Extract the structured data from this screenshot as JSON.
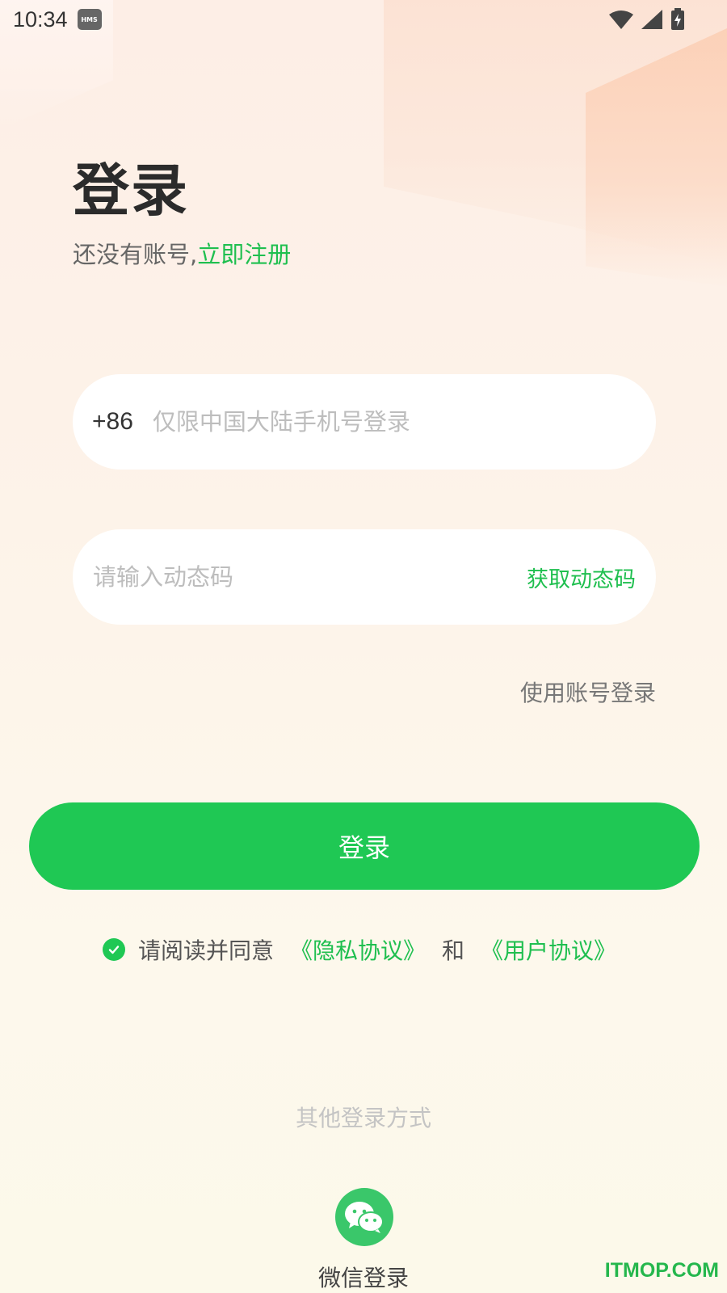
{
  "status_bar": {
    "time": "10:34",
    "hms_badge": "HMS",
    "icons": [
      "wifi-icon",
      "signal-icon",
      "battery-charging-icon"
    ]
  },
  "header": {
    "title": "登录",
    "subtitle_prefix": "还没有账号,",
    "register_link": "立即注册"
  },
  "phone_field": {
    "prefix": "+86",
    "placeholder": "仅限中国大陆手机号登录",
    "value": ""
  },
  "code_field": {
    "placeholder": "请输入动态码",
    "value": "",
    "get_code_label": "获取动态码"
  },
  "account_login_link": "使用账号登录",
  "login_button": "登录",
  "agreement": {
    "checked": true,
    "prefix": "请阅读并同意",
    "privacy_link": "《隐私协议》",
    "and_text": "和",
    "user_link": "《用户协议》"
  },
  "other_methods": {
    "label": "其他登录方式",
    "wechat_label": "微信登录"
  },
  "watermark": "ITMOP.COM",
  "colors": {
    "accent_green": "#1fc854",
    "link_green": "#1fbf4f",
    "wechat_green": "#3ac76a"
  }
}
